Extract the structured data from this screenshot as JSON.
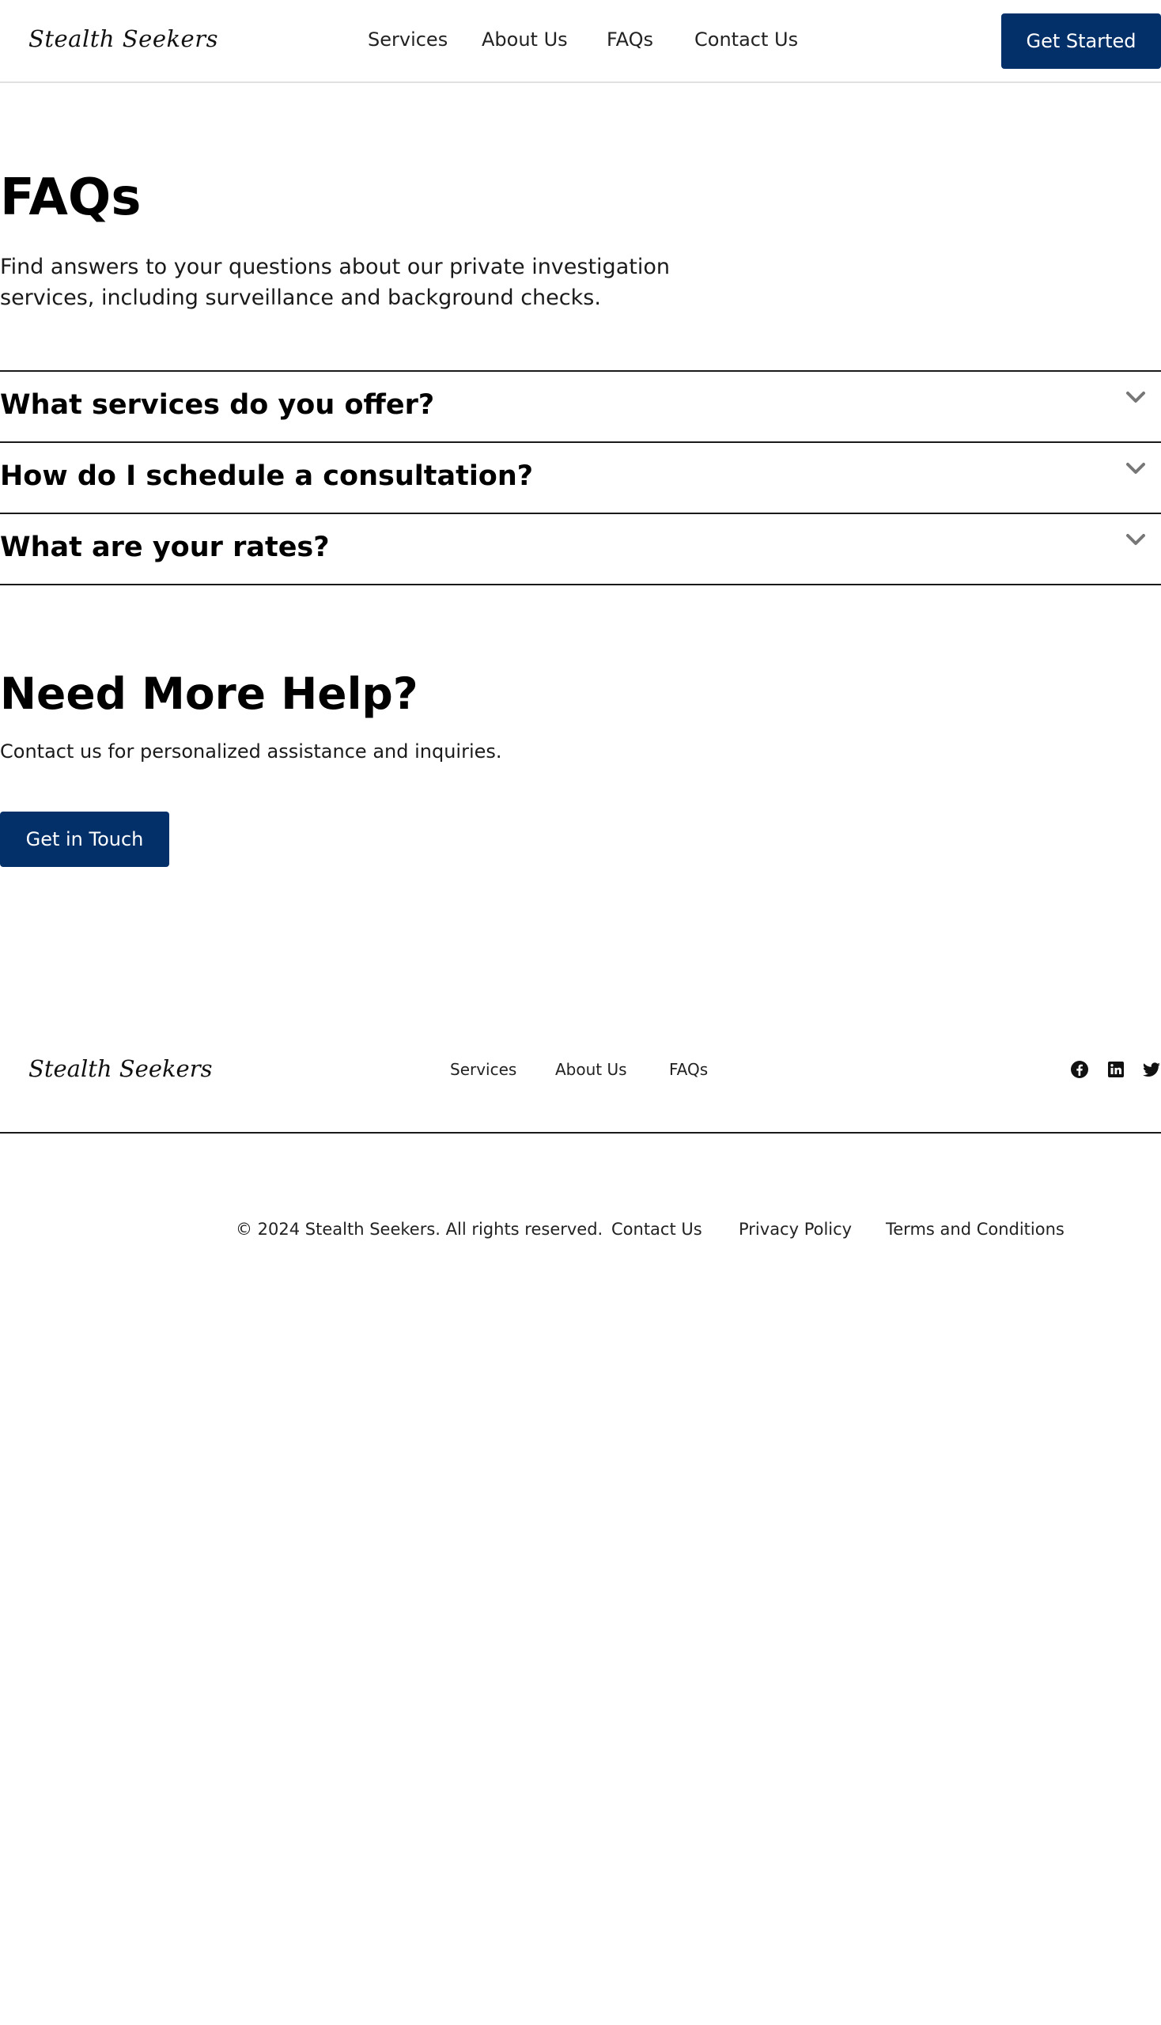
{
  "header": {
    "logo": "Stealth Seekers",
    "nav": [
      "Services",
      "About Us",
      "FAQs",
      "Contact Us"
    ],
    "cta": "Get Started"
  },
  "hero": {
    "title": "FAQs",
    "subtitle": "Find answers to your questions about our private investigation services, including surveillance and background checks."
  },
  "faqs": [
    {
      "question": "What services do you offer?",
      "icon": "chevron-down-icon"
    },
    {
      "question": "How do I schedule a consultation?",
      "icon": "chevron-down-icon"
    },
    {
      "question": "What are your rates?",
      "icon": "chevron-down-icon"
    }
  ],
  "help": {
    "title": "Need More Help?",
    "subtitle": "Contact us for personalized assistance and inquiries.",
    "cta": "Get in Touch"
  },
  "footer": {
    "logo": "Stealth Seekers",
    "nav": [
      "Services",
      "About Us",
      "FAQs"
    ],
    "social": [
      "facebook-icon",
      "linkedin-icon",
      "twitter-icon"
    ],
    "copyright": "© 2024 Stealth Seekers. All rights reserved.",
    "legal_links": [
      "Contact Us",
      "Privacy Policy",
      "Terms and Conditions"
    ]
  },
  "colors": {
    "accent": "#04306a",
    "text": "#111111",
    "divider": "#1a1a1a"
  }
}
